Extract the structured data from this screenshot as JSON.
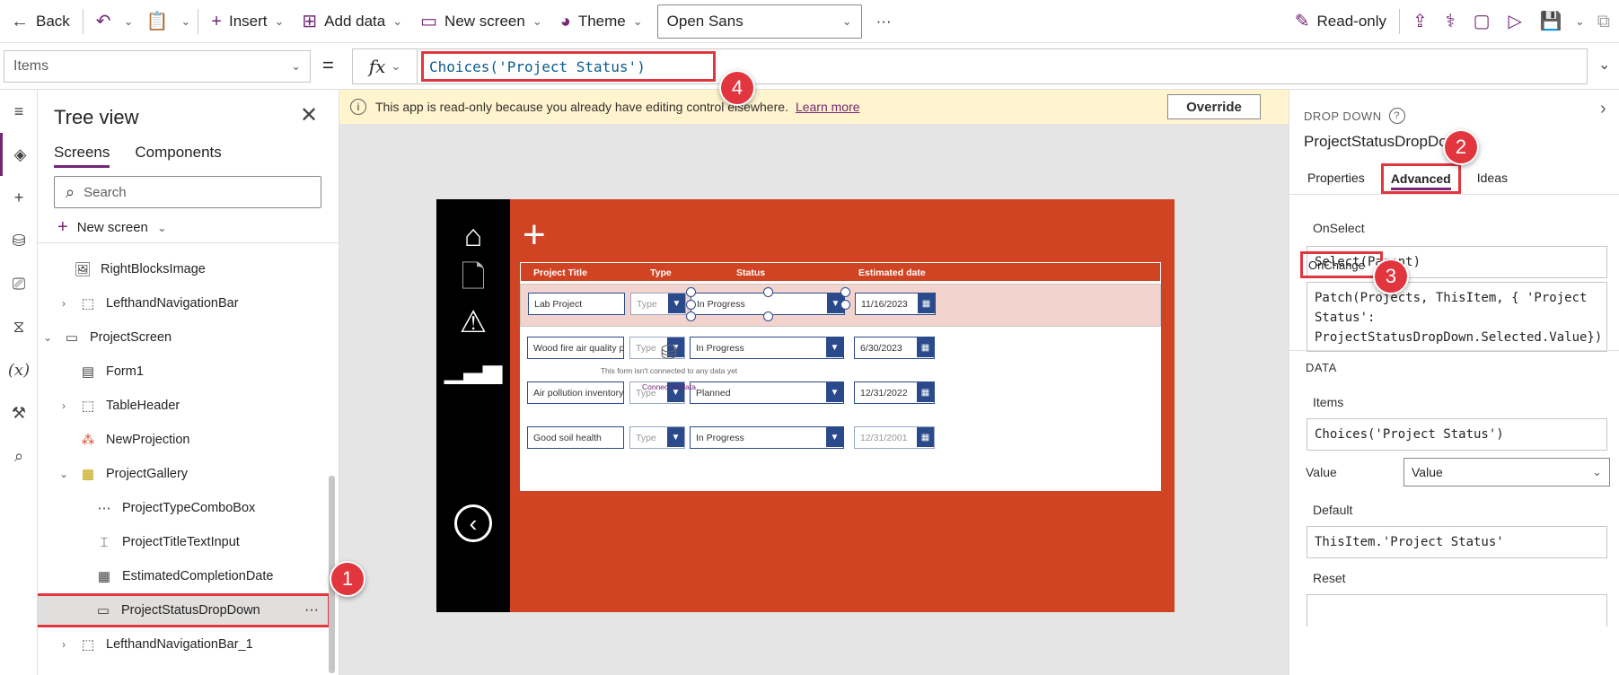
{
  "toolbar": {
    "back": "Back",
    "insert": "Insert",
    "add_data": "Add data",
    "new_screen": "New screen",
    "theme": "Theme",
    "font": "Open Sans",
    "more": "···",
    "read_only": "Read-only"
  },
  "formula_bar": {
    "property": "Items",
    "equals": "=",
    "fx": "fx",
    "formula": "Choices('Project Status')"
  },
  "tree_view": {
    "title": "Tree view",
    "tabs": [
      "Screens",
      "Components"
    ],
    "search_placeholder": "Search",
    "new_screen": "New screen",
    "nodes": [
      {
        "label": "RightBlocksImage"
      },
      {
        "label": "LefthandNavigationBar"
      },
      {
        "label": "ProjectScreen"
      },
      {
        "label": "Form1"
      },
      {
        "label": "TableHeader"
      },
      {
        "label": "NewProjection"
      },
      {
        "label": "ProjectGallery"
      },
      {
        "label": "ProjectTypeComboBox"
      },
      {
        "label": "ProjectTitleTextInput"
      },
      {
        "label": "EstimatedCompletionDate"
      },
      {
        "label": "ProjectStatusDropDown"
      },
      {
        "label": "LefthandNavigationBar_1"
      }
    ],
    "node_more": "···"
  },
  "banner": {
    "message": "This app is read-only because you already have editing control elsewhere.",
    "learn_more": "Learn more",
    "override": "Override"
  },
  "app": {
    "headers": [
      "Project Title",
      "Type",
      "Status",
      "Estimated date"
    ],
    "rows": [
      {
        "title": "Lab Project",
        "type": "Type",
        "status": "In Progress",
        "date": "11/16/2023"
      },
      {
        "title": "Wood fire air quality pro",
        "type": "Type",
        "status": "In Progress",
        "date": "6/30/2023"
      },
      {
        "title": "Air pollution inventory p",
        "type": "Type",
        "status": "Planned",
        "date": "12/31/2022"
      },
      {
        "title": "Good soil health",
        "type": "Type",
        "status": "In Progress",
        "date": "12/31/2001"
      }
    ],
    "form_notice": "This form isn't connected to any data yet",
    "connect_link": "Connect to data"
  },
  "properties": {
    "control_type": "DROP DOWN",
    "control_name": "ProjectStatusDropDown",
    "tabs": [
      "Properties",
      "Advanced",
      "Ideas"
    ],
    "onselect_label": "OnSelect",
    "onselect_value": "Select(Parent)",
    "onchange_label": "OnChange",
    "onchange_value": "Patch(Projects, ThisItem, { 'Project Status': ProjectStatusDropDown.Selected.Value})",
    "data_section": "DATA",
    "items_label": "Items",
    "items_value": "Choices('Project Status')",
    "value_label": "Value",
    "value_value": "Value",
    "default_label": "Default",
    "default_value": "ThisItem.'Project Status'",
    "reset_label": "Reset"
  },
  "badges": [
    "1",
    "2",
    "3",
    "4"
  ],
  "colors": {
    "accent": "#742774",
    "highlight": "#e2363f",
    "app_background": "#d04423",
    "nav": "#000000"
  }
}
